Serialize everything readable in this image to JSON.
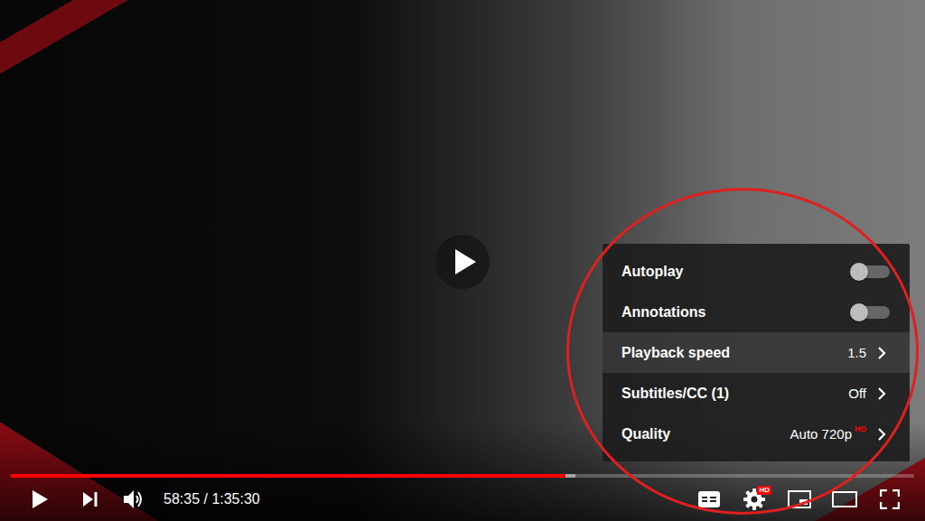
{
  "player": {
    "playing": false
  },
  "progress": {
    "level": 0.614,
    "buffer_level": 0.625
  },
  "time": "58:35 / 1:35:30",
  "settings_button": {
    "badge": "HD"
  },
  "settings_menu": {
    "items": [
      {
        "label": "Autoplay",
        "kind": "toggle",
        "on": false,
        "selected": false
      },
      {
        "label": "Annotations",
        "kind": "toggle",
        "on": false,
        "selected": false
      },
      {
        "label": "Playback speed",
        "kind": "submenu",
        "value": "1.5",
        "selected": true
      },
      {
        "label": "Subtitles/CC (1)",
        "kind": "submenu",
        "value": "Off",
        "selected": false
      },
      {
        "label": "Quality",
        "kind": "submenu",
        "value": "Auto 720p",
        "badge": "HD",
        "selected": false
      }
    ]
  }
}
